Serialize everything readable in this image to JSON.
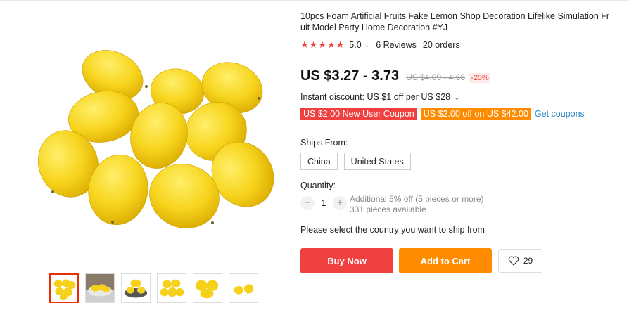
{
  "product": {
    "title": "10pcs Foam Artificial Fruits Fake Lemon Shop Decoration Lifelike Simulation Fr uit Model Party Home Decoration #YJ",
    "stars": "★★★★★",
    "rating": "5.0",
    "rating_caret": "⌄",
    "reviews": "6 Reviews",
    "orders": "20 orders"
  },
  "price": {
    "current": "US $3.27 - 3.73",
    "original": "US $4.09 - 4.66",
    "discount": "-20%"
  },
  "promo": {
    "instant_discount": "Instant discount: US $1 off per US $28",
    "instant_caret": "⌄",
    "coupons": [
      {
        "label": "US $2.00 New User Coupon",
        "color": "#f0403f"
      },
      {
        "label": "US $2.00 off on US $42.00",
        "color": "#ff8c00"
      }
    ],
    "get_coupons": "Get coupons"
  },
  "shipping": {
    "label": "Ships From:",
    "options": [
      "China",
      "United States"
    ],
    "note": "Please select the country you want to ship from"
  },
  "quantity": {
    "label": "Quantity:",
    "minus_icon": "−",
    "plus_icon": "+",
    "value": "1",
    "bulk_note": "Additional 5% off (5 pieces or more)",
    "available": "331 pieces available"
  },
  "actions": {
    "buy_now": "Buy Now",
    "add_to_cart": "Add to Cart",
    "wishlist_count": "29",
    "wishlist_icon": "heart-outline-icon"
  },
  "gallery": {
    "main_image": "lemons-main-image",
    "thumbnails": [
      "lemons-top-view",
      "lemons-in-bowl",
      "lemons-on-plate",
      "lemons-pile",
      "lemons-close-up",
      "two-lemons"
    ],
    "selected_index": 0
  },
  "colors": {
    "accent_red": "#f0403f",
    "accent_orange": "#ff8c00",
    "link_blue": "#2a87c4"
  }
}
